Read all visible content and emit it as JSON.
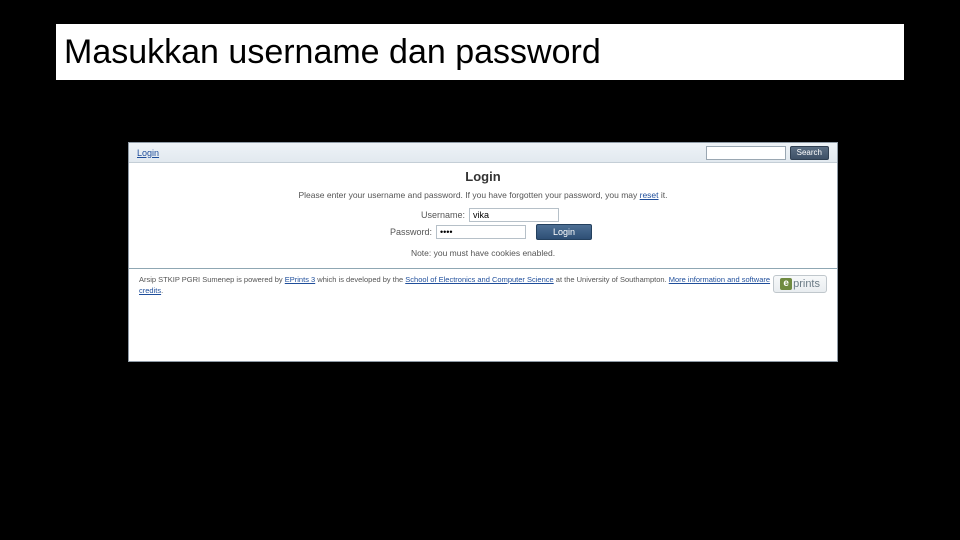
{
  "slide": {
    "title": "Masukkan username dan password"
  },
  "topbar": {
    "login_link": "Login",
    "search_button": "Search",
    "search_value": ""
  },
  "login": {
    "heading": "Login",
    "instruction_pre": "Please enter your username and password. If you have forgotten your password, you may ",
    "reset_link": "reset",
    "instruction_post": " it.",
    "username_label": "Username:",
    "username_value": "vika",
    "password_label": "Password:",
    "password_value": "••••",
    "login_button": "Login",
    "cookies_note": "Note: you must have cookies enabled."
  },
  "footer": {
    "text_1": "Arsip STKIP PGRI Sumenep is powered by ",
    "link_1": "EPrints 3",
    "text_2": " which is developed by the ",
    "link_2": "School of Electronics and Computer Science",
    "text_3": " at the University of Southampton. ",
    "link_3": "More information and software credits",
    "text_4": ".",
    "logo_text": "prints"
  }
}
